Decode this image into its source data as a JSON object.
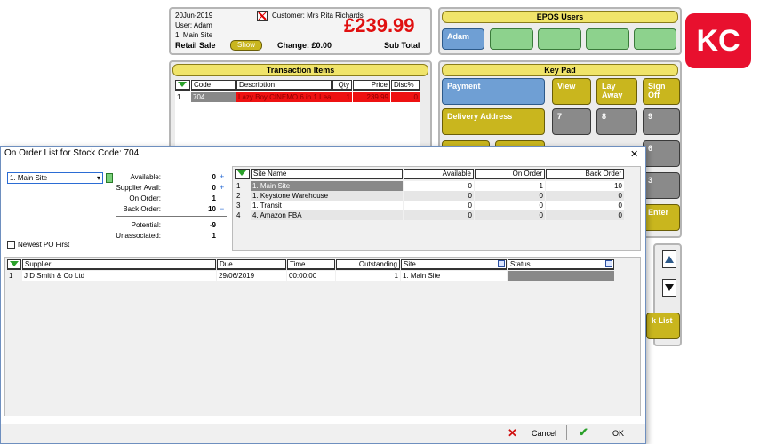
{
  "header_info": {
    "date": "20Jun-2019",
    "user": "User: Adam",
    "site": "1. Main Site",
    "sale_type": "Retail Sale",
    "show_label": "Show",
    "customer": "Customer: Mrs Rita Richards",
    "total": "£239.99",
    "change": "Change: £0.00",
    "subtotal_label": "Sub Total"
  },
  "epos_users": {
    "title": "EPOS Users",
    "users": [
      "Adam"
    ]
  },
  "transaction": {
    "title": "Transaction Items",
    "columns": [
      "Code",
      "Description",
      "Qty",
      "Price",
      "Disc%"
    ],
    "rows": [
      {
        "n": "1",
        "code": "704",
        "desc": "Lazy Boy CINEMO 6 in 1 Lea",
        "qty": "1",
        "price": "239.99",
        "disc": "0"
      }
    ]
  },
  "keypad": {
    "title": "Key Pad",
    "buttons": [
      "Payment",
      "View",
      "Lay Away",
      "Sign Off",
      "Delivery Address",
      "7",
      "8",
      "9",
      "6",
      "3",
      "Enter"
    ],
    "list_label": "k List"
  },
  "logo": {
    "text": "KC",
    "color": "#e8102e"
  },
  "dialog": {
    "title": "On Order List for Stock Code: 704",
    "close": "✕",
    "site_select": "1. Main Site",
    "stats": [
      {
        "label": "Available:",
        "value": "0",
        "plus": "+"
      },
      {
        "label": "Supplier Avail:",
        "value": "0",
        "plus": "+"
      },
      {
        "label": "On Order:",
        "value": "1",
        "plus": ""
      },
      {
        "label": "Back Order:",
        "value": "10",
        "plus": "−"
      },
      {
        "label": "Potential:",
        "value": "-9",
        "plus": ""
      },
      {
        "label": "Unassociated:",
        "value": "1",
        "plus": ""
      }
    ],
    "newest_po": "Newest PO First",
    "site_columns": [
      "Site Name",
      "Available",
      "On Order",
      "Back Order"
    ],
    "site_rows": [
      {
        "n": "1",
        "name": "1. Main Site",
        "avail": "0",
        "onorder": "1",
        "back": "10"
      },
      {
        "n": "2",
        "name": "1. Keystone Warehouse",
        "avail": "0",
        "onorder": "0",
        "back": "0"
      },
      {
        "n": "3",
        "name": "1. Transit",
        "avail": "0",
        "onorder": "0",
        "back": "0"
      },
      {
        "n": "4",
        "name": "4. Amazon FBA",
        "avail": "0",
        "onorder": "0",
        "back": "0"
      }
    ],
    "po_columns": [
      "Supplier",
      "Due",
      "Time",
      "Outstanding",
      "Site",
      "Status"
    ],
    "po_rows": [
      {
        "n": "1",
        "supplier": "J D Smith & Co Ltd",
        "due": "29/06/2019",
        "time": "00:00:00",
        "out": "1",
        "site": "1. Main Site",
        "status": ""
      }
    ],
    "cancel": "Cancel",
    "ok": "OK"
  }
}
